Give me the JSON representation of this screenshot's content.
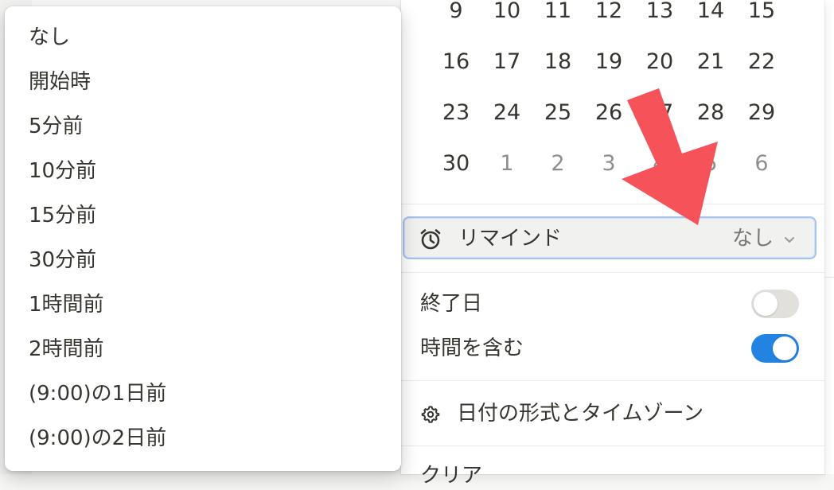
{
  "calendar": {
    "weeks": [
      [
        {
          "d": "9"
        },
        {
          "d": "10"
        },
        {
          "d": "11"
        },
        {
          "d": "12"
        },
        {
          "d": "13"
        },
        {
          "d": "14"
        },
        {
          "d": "15"
        }
      ],
      [
        {
          "d": "16"
        },
        {
          "d": "17"
        },
        {
          "d": "18"
        },
        {
          "d": "19"
        },
        {
          "d": "20"
        },
        {
          "d": "21"
        },
        {
          "d": "22"
        }
      ],
      [
        {
          "d": "23"
        },
        {
          "d": "24"
        },
        {
          "d": "25"
        },
        {
          "d": "26"
        },
        {
          "d": "27"
        },
        {
          "d": "28"
        },
        {
          "d": "29"
        }
      ],
      [
        {
          "d": "30"
        },
        {
          "d": "1",
          "muted": true
        },
        {
          "d": "2",
          "muted": true
        },
        {
          "d": "3",
          "muted": true
        },
        {
          "d": "4",
          "muted": true
        },
        {
          "d": "5",
          "muted": true
        },
        {
          "d": "6",
          "muted": true
        }
      ]
    ]
  },
  "remind": {
    "label": "リマインド",
    "value": "なし",
    "icon": "alarm-clock-icon"
  },
  "end_date": {
    "label": "終了日",
    "enabled": false
  },
  "include_time": {
    "label": "時間を含む",
    "enabled": true
  },
  "format": {
    "label": "日付の形式とタイムゾーン",
    "icon": "gear-icon"
  },
  "clear": {
    "label": "クリア"
  },
  "menu": {
    "items": [
      {
        "label": "なし"
      },
      {
        "label": "開始時"
      },
      {
        "label": "5分前"
      },
      {
        "label": "10分前"
      },
      {
        "label": "15分前"
      },
      {
        "label": "30分前"
      },
      {
        "label": "1時間前"
      },
      {
        "label": "2時間前"
      },
      {
        "label": "(9:00)の1日前"
      },
      {
        "label": "(9:00)の2日前"
      }
    ]
  },
  "colors": {
    "accent": "#2383e2",
    "arrow": "#f5525a"
  }
}
